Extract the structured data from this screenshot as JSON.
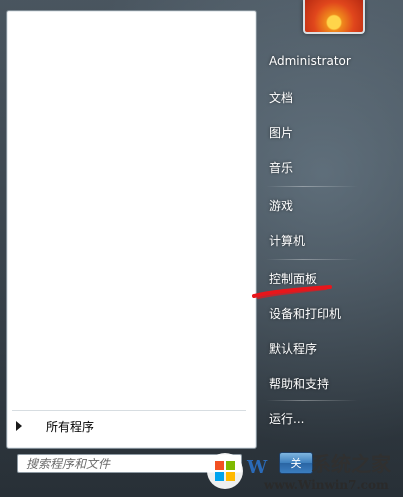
{
  "all_programs": {
    "label": "所有程序"
  },
  "search": {
    "placeholder": "搜索程序和文件"
  },
  "user": {
    "name": "Administrator"
  },
  "right_items": [
    {
      "label": "文档"
    },
    {
      "label": "图片"
    },
    {
      "label": "音乐"
    },
    {
      "label": "游戏"
    },
    {
      "label": "计算机"
    },
    {
      "label": "控制面板"
    },
    {
      "label": "设备和打印机"
    },
    {
      "label": "默认程序"
    },
    {
      "label": "帮助和支持"
    },
    {
      "label": "运行..."
    }
  ],
  "shutdown": {
    "label": "关"
  },
  "watermark": {
    "brand_cn": "系统之家",
    "url": "www.Winwin7.com"
  },
  "colors": {
    "annotation_red": "#e8161b",
    "text_white": "#ffffff",
    "pane_white": "#ffffff"
  }
}
